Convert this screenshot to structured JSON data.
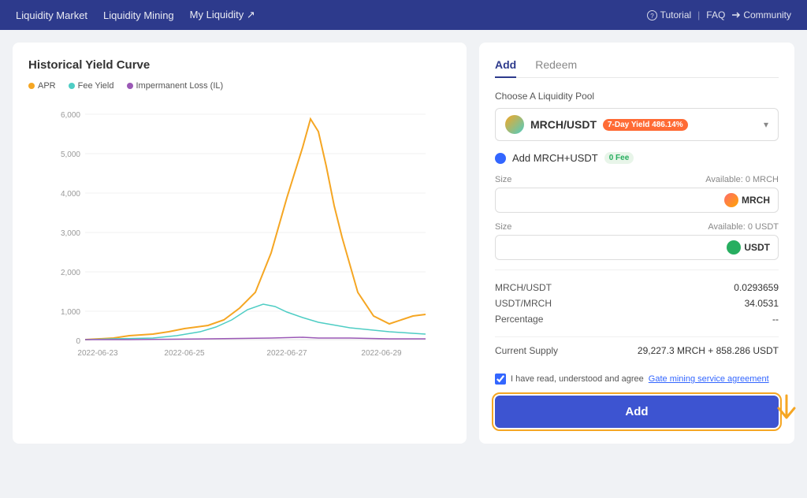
{
  "header": {
    "nav_items": [
      {
        "label": "Liquidity Market",
        "id": "liquidity-market"
      },
      {
        "label": "Liquidity Mining",
        "id": "liquidity-mining"
      },
      {
        "label": "My Liquidity ↗",
        "id": "my-liquidity"
      }
    ],
    "right_links": [
      {
        "label": "Tutorial",
        "id": "tutorial"
      },
      {
        "label": "FAQ",
        "id": "faq"
      },
      {
        "label": "Community",
        "id": "community"
      }
    ]
  },
  "chart": {
    "title": "Historical Yield Curve",
    "legend": [
      {
        "label": "APR",
        "class": "apr"
      },
      {
        "label": "Fee Yield",
        "class": "fee"
      },
      {
        "label": "Impermanent Loss (IL)",
        "class": "il"
      }
    ],
    "y_labels": [
      "6,000",
      "5,000",
      "4,000",
      "3,000",
      "2,000",
      "1,000",
      "0"
    ],
    "x_labels": [
      "2022-06-23",
      "2022-06-25",
      "2022-06-27",
      "2022-06-29"
    ]
  },
  "right_panel": {
    "tabs": [
      {
        "label": "Add",
        "active": true
      },
      {
        "label": "Redeem",
        "active": false
      }
    ],
    "pool_label": "Choose A Liquidity Pool",
    "pool": {
      "name": "MRCH/USDT",
      "yield_text": "7-Day Yield 486.14%"
    },
    "add_label": "Add MRCH+USDT",
    "fee_label": "0 Fee",
    "size1": {
      "label": "Size",
      "available": "Available: 0 MRCH",
      "token": "MRCH"
    },
    "size2": {
      "label": "Size",
      "available": "Available: 0 USDT",
      "token": "USDT"
    },
    "info_rows": [
      {
        "label": "MRCH/USDT",
        "value": "0.0293659"
      },
      {
        "label": "USDT/MRCH",
        "value": "34.0531"
      },
      {
        "label": "Percentage",
        "value": "--"
      }
    ],
    "supply": {
      "label": "Current Supply",
      "value": "29,227.3 MRCH + 858.286 USDT"
    },
    "agreement_text": "I have read, understood and agree",
    "agreement_link": "Gate mining service agreement",
    "add_button": "Add"
  }
}
